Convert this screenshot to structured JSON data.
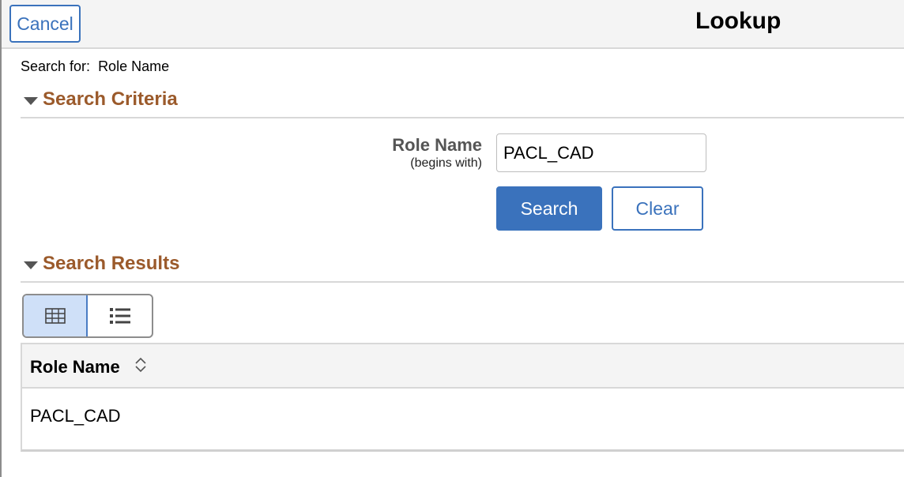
{
  "header": {
    "cancel_label": "Cancel",
    "title": "Lookup"
  },
  "search_for": {
    "prefix": "Search for:",
    "field": "Role Name"
  },
  "criteria": {
    "section_title": "Search Criteria",
    "field_label": "Role Name",
    "field_operator": "(begins with)",
    "field_value": "PACL_CAD",
    "search_label": "Search",
    "clear_label": "Clear"
  },
  "results": {
    "section_title": "Search Results",
    "view_modes": [
      {
        "icon": "grid-view-icon",
        "active": true
      },
      {
        "icon": "list-view-icon",
        "active": false
      }
    ],
    "columns": [
      "Role Name"
    ],
    "rows": [
      [
        "PACL_CAD"
      ]
    ]
  },
  "colors": {
    "accent_blue": "#3a72bc",
    "section_title": "#9b5a2b",
    "header_bg": "#f4f4f4"
  }
}
